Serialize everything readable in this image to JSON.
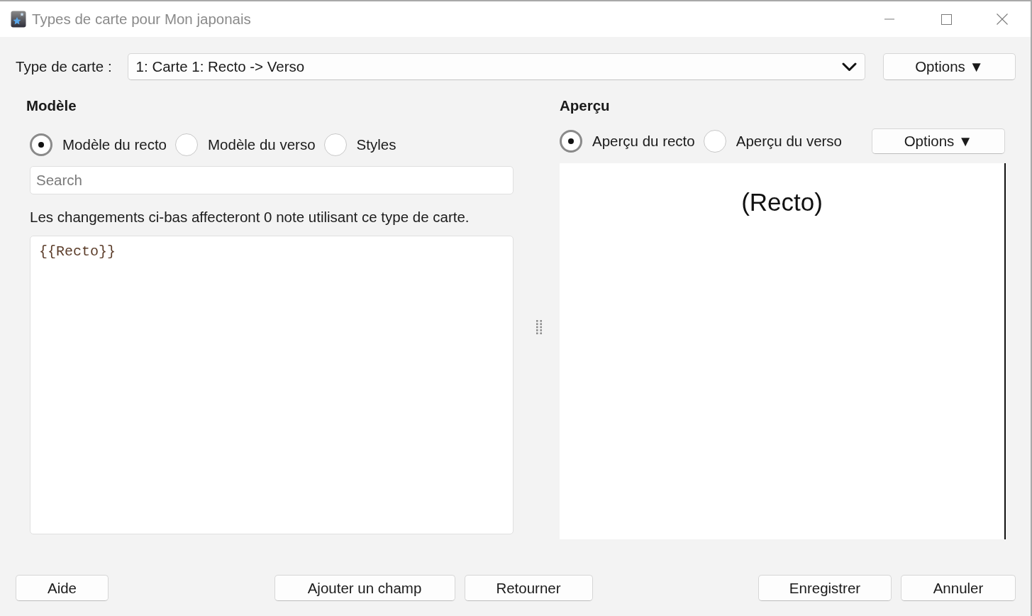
{
  "window": {
    "title": "Types de carte pour Mon japonais"
  },
  "card_type": {
    "label": "Type de carte :",
    "value": "1: Carte 1: Recto -> Verso",
    "options_button": "Options ▼"
  },
  "template": {
    "heading": "Modèle",
    "radios": [
      {
        "label": "Modèle du recto",
        "selected": true
      },
      {
        "label": "Modèle du verso",
        "selected": false
      },
      {
        "label": "Styles",
        "selected": false
      }
    ],
    "search": {
      "placeholder": "Search"
    },
    "info": "Les changements ci-bas affecteront 0 note utilisant ce type de carte.",
    "editor": {
      "value": "{{Recto}}"
    }
  },
  "preview": {
    "heading": "Aperçu",
    "radios": [
      {
        "label": "Aperçu du recto",
        "selected": true
      },
      {
        "label": "Aperçu du verso",
        "selected": false
      }
    ],
    "options_button": "Options ▼",
    "content": "(Recto)"
  },
  "button_groups": [
    [
      "Aide"
    ],
    [
      "Ajouter un champ",
      "Retourner"
    ],
    [
      "Enregistrer",
      "Annuler"
    ]
  ]
}
